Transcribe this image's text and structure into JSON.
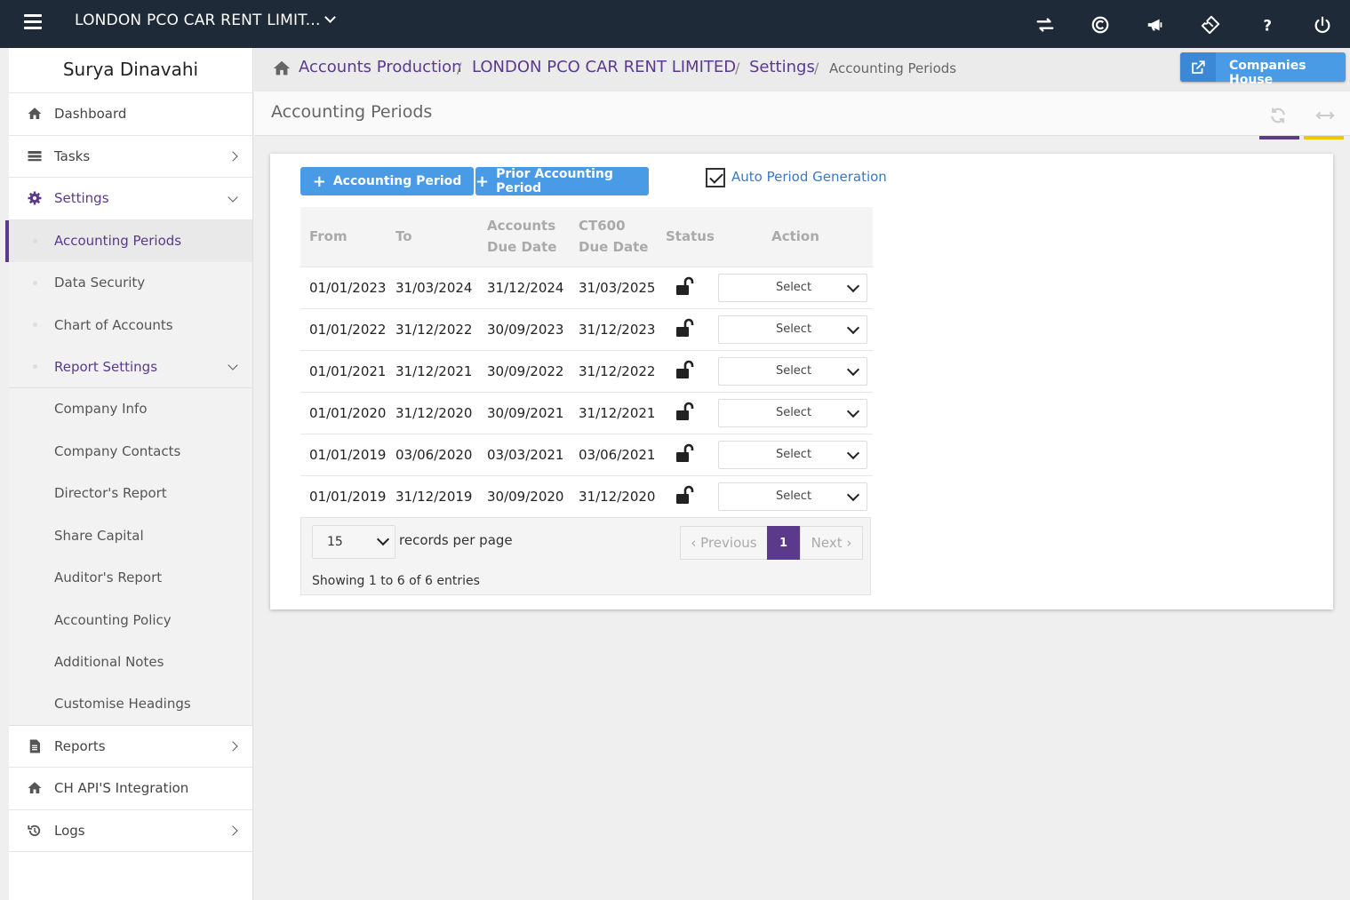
{
  "topbar": {
    "company": "LONDON PCO CAR RENT LIMIT...",
    "icons": [
      "menu-icon",
      "swap-icon",
      "copyright-icon",
      "megaphone-icon",
      "ticket-icon",
      "help-icon",
      "power-icon"
    ]
  },
  "sidebar": {
    "user": "Surya Dinavahi",
    "items": {
      "dashboard": "Dashboard",
      "tasks": "Tasks",
      "settings": "Settings",
      "reports": "Reports",
      "ch_api": "CH API'S Integration",
      "logs": "Logs"
    },
    "settings_sub": {
      "accounting_periods": "Accounting Periods",
      "data_security": "Data Security",
      "chart_of_accounts": "Chart of Accounts",
      "report_settings": "Report Settings"
    },
    "report_sub": {
      "company_info": "Company Info",
      "company_contacts": "Company Contacts",
      "directors_report": "Director's Report",
      "share_capital": "Share Capital",
      "auditors_report": "Auditor's Report",
      "accounting_policy": "Accounting Policy",
      "additional_notes": "Additional Notes",
      "customise_headings": "Customise Headings"
    }
  },
  "breadcrumb": {
    "accounts_production": "Accounts Production",
    "company": "LONDON PCO CAR RENT LIMITED",
    "settings": "Settings",
    "current": "Accounting Periods",
    "sep": "/"
  },
  "companies_house": "Companies House",
  "page_title": "Accounting Periods",
  "actions": {
    "add_period": "Accounting Period",
    "add_prior": "Prior Accounting Period",
    "auto_generation": "Auto Period Generation",
    "plus": "+"
  },
  "table": {
    "headers": {
      "from": "From",
      "to": "To",
      "accounts_due_1": "Accounts",
      "accounts_due_2": "Due Date",
      "ct600_1": "CT600",
      "ct600_2": "Due Date",
      "status": "Status",
      "action": "Action"
    },
    "rows": [
      {
        "from": "01/01/2023",
        "to": "31/03/2024",
        "acc_due": "31/12/2024",
        "ct600_due": "31/03/2025",
        "action": "Select"
      },
      {
        "from": "01/01/2022",
        "to": "31/12/2022",
        "acc_due": "30/09/2023",
        "ct600_due": "31/12/2023",
        "action": "Select"
      },
      {
        "from": "01/01/2021",
        "to": "31/12/2021",
        "acc_due": "30/09/2022",
        "ct600_due": "31/12/2022",
        "action": "Select"
      },
      {
        "from": "01/01/2020",
        "to": "31/12/2020",
        "acc_due": "30/09/2021",
        "ct600_due": "31/12/2021",
        "action": "Select"
      },
      {
        "from": "01/01/2019",
        "to": "03/06/2020",
        "acc_due": "03/03/2021",
        "ct600_due": "03/06/2021",
        "action": "Select"
      },
      {
        "from": "01/01/2019",
        "to": "31/12/2019",
        "acc_due": "30/09/2020",
        "ct600_due": "31/12/2020",
        "action": "Select"
      }
    ]
  },
  "pagination": {
    "per_page": "15",
    "per_page_label": "records per page",
    "previous": "‹ Previous",
    "page": "1",
    "next": "Next ›",
    "showing": "Showing 1 to 6 of 6 entries"
  },
  "colors": {
    "brand": "#5b3a8c",
    "topbar": "#1f2a38",
    "button": "#4a9be6",
    "accent_yellow": "#f5c400"
  }
}
